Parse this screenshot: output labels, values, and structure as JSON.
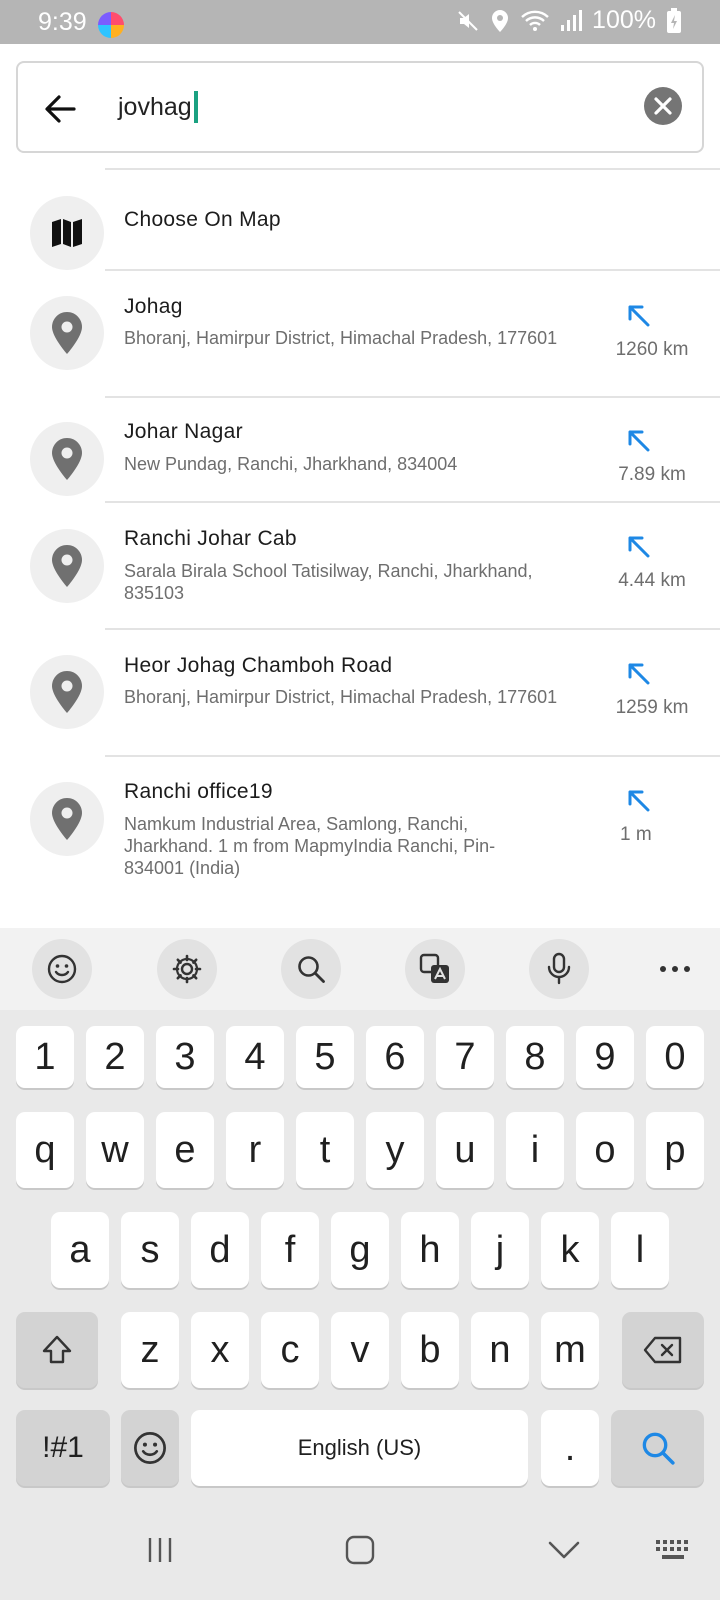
{
  "status_bar": {
    "time": "9:39",
    "battery": "100%"
  },
  "search": {
    "query": "jovhag"
  },
  "choose_on_map": {
    "label": "Choose On Map"
  },
  "results": [
    {
      "title": "Johag",
      "subtitle": "Bhoranj, Hamirpur District, Himachal Pradesh, 177601",
      "distance": "1260 km"
    },
    {
      "title": "Johar Nagar",
      "subtitle": "New Pundag, Ranchi, Jharkhand, 834004",
      "distance": "7.89 km"
    },
    {
      "title": "Ranchi Johar Cab",
      "subtitle": "Sarala Birala School Tatisilway, Ranchi, Jharkhand, 835103",
      "distance": "4.44 km"
    },
    {
      "title": "Heor Johag Chamboh Road",
      "subtitle": "Bhoranj, Hamirpur District, Himachal Pradesh, 177601",
      "distance": "1259 km"
    },
    {
      "title": "Ranchi office19",
      "subtitle": "Namkum Industrial Area, Samlong, Ranchi, Jharkhand. 1 m from MapmyIndia Ranchi, Pin-834001 (India)",
      "distance": "1 m"
    }
  ],
  "keyboard": {
    "number_row": [
      "1",
      "2",
      "3",
      "4",
      "5",
      "6",
      "7",
      "8",
      "9",
      "0"
    ],
    "row1": [
      "q",
      "w",
      "e",
      "r",
      "t",
      "y",
      "u",
      "i",
      "o",
      "p"
    ],
    "row2": [
      "a",
      "s",
      "d",
      "f",
      "g",
      "h",
      "j",
      "k",
      "l"
    ],
    "row3": [
      "z",
      "x",
      "c",
      "v",
      "b",
      "n",
      "m"
    ],
    "symbols_label": "!#1",
    "space_label": "English (US)",
    "period_label": "."
  },
  "colors": {
    "accent_caret": "#1aa181",
    "direction_arrow": "#1e88e5",
    "status_bar_bg": "#b5b5b5"
  },
  "icons": {
    "back": "arrow-left-icon",
    "clear": "clear-x-icon",
    "map": "map-icon",
    "place": "location-pin-icon",
    "direction": "arrow-up-left-icon"
  }
}
